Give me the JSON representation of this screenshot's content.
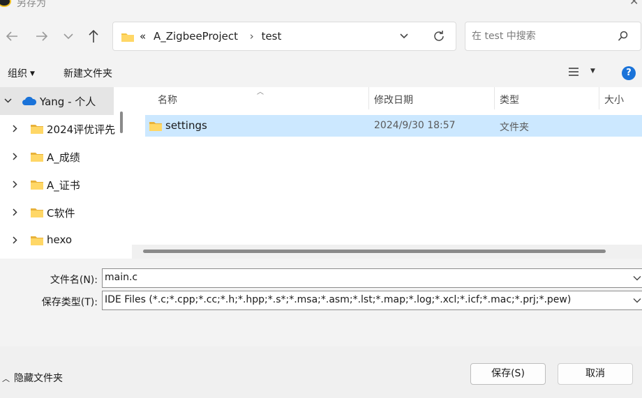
{
  "window": {
    "title": "另存为"
  },
  "address": {
    "crumbs": [
      "«",
      "A_ZigbeeProject",
      "test"
    ]
  },
  "search": {
    "placeholder": "在 test 中搜索"
  },
  "commands": {
    "organize": "组织",
    "new_folder": "新建文件夹"
  },
  "tree": {
    "items": [
      {
        "label": "Yang - 个人",
        "icon": "onedrive-cloud-icon",
        "expanded": true,
        "selected": true
      },
      {
        "label": "2024评优评先",
        "icon": "folder-icon"
      },
      {
        "label": "A_成绩",
        "icon": "folder-icon"
      },
      {
        "label": "A_证书",
        "icon": "folder-icon"
      },
      {
        "label": "C软件",
        "icon": "folder-icon"
      },
      {
        "label": "hexo",
        "icon": "folder-icon"
      }
    ]
  },
  "files": {
    "columns": [
      "名称",
      "修改日期",
      "类型",
      "大小"
    ],
    "rows": [
      {
        "name": "settings",
        "date": "2024/9/30 18:57",
        "type": "文件夹",
        "size": ""
      }
    ]
  },
  "form": {
    "filename_label": "文件名(N):",
    "filename_value": "main.c",
    "filetype_label": "保存类型(T):",
    "filetype_value": "IDE Files (*.c;*.cpp;*.cc;*.h;*.hpp;*.s*;*.msa;*.asm;*.lst;*.map;*.log;*.xcl;*.icf;*.mac;*.prj;*.pew)"
  },
  "footer": {
    "hide_folders": "隐藏文件夹",
    "save": "保存(S)",
    "cancel": "取消"
  },
  "colors": {
    "accent": "#1a73d9",
    "selection": "#cce8ff",
    "folder": "#f5c542"
  }
}
